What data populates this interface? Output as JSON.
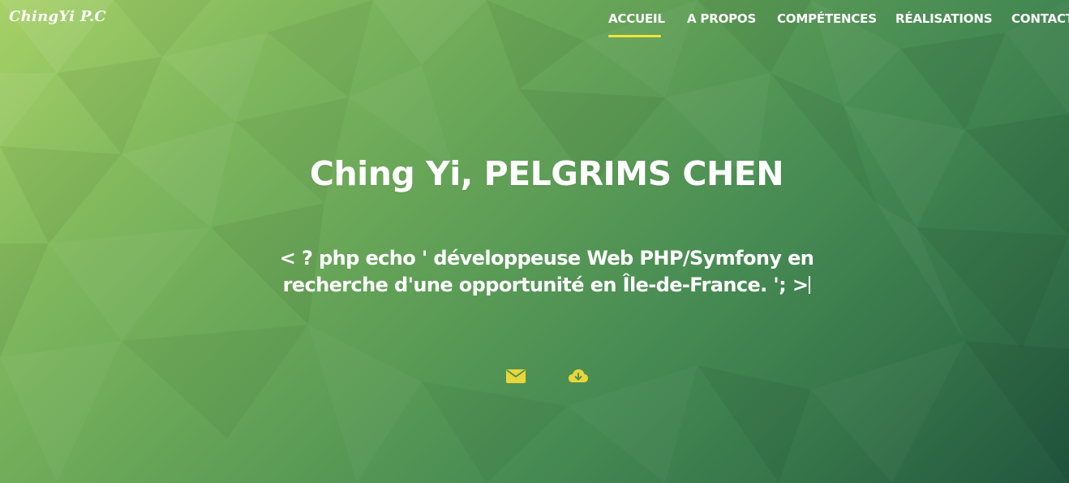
{
  "brand": {
    "label": "ChingYi P.C"
  },
  "nav": {
    "items": [
      {
        "label": "ACCUEIL",
        "active": true
      },
      {
        "label": "A PROPOS",
        "active": false
      },
      {
        "label": "COMPÉTENCES",
        "active": false
      },
      {
        "label": "RÉALISATIONS",
        "active": false
      },
      {
        "label": "CONTACT",
        "active": false
      }
    ]
  },
  "hero": {
    "title": "Ching Yi, PELGRIMS CHEN",
    "tagline": "< ? php echo ' développeuse Web PHP/Symfony en recherche d'une opportunité en Île-de-France. '; >"
  },
  "actions": [
    {
      "icon": "envelope-icon"
    },
    {
      "icon": "cloud-download-icon"
    }
  ],
  "colors": {
    "accent": "#f2e23a",
    "icon": "#e9d63a",
    "background_light": "#a6d166",
    "background_dark": "#22573f"
  }
}
